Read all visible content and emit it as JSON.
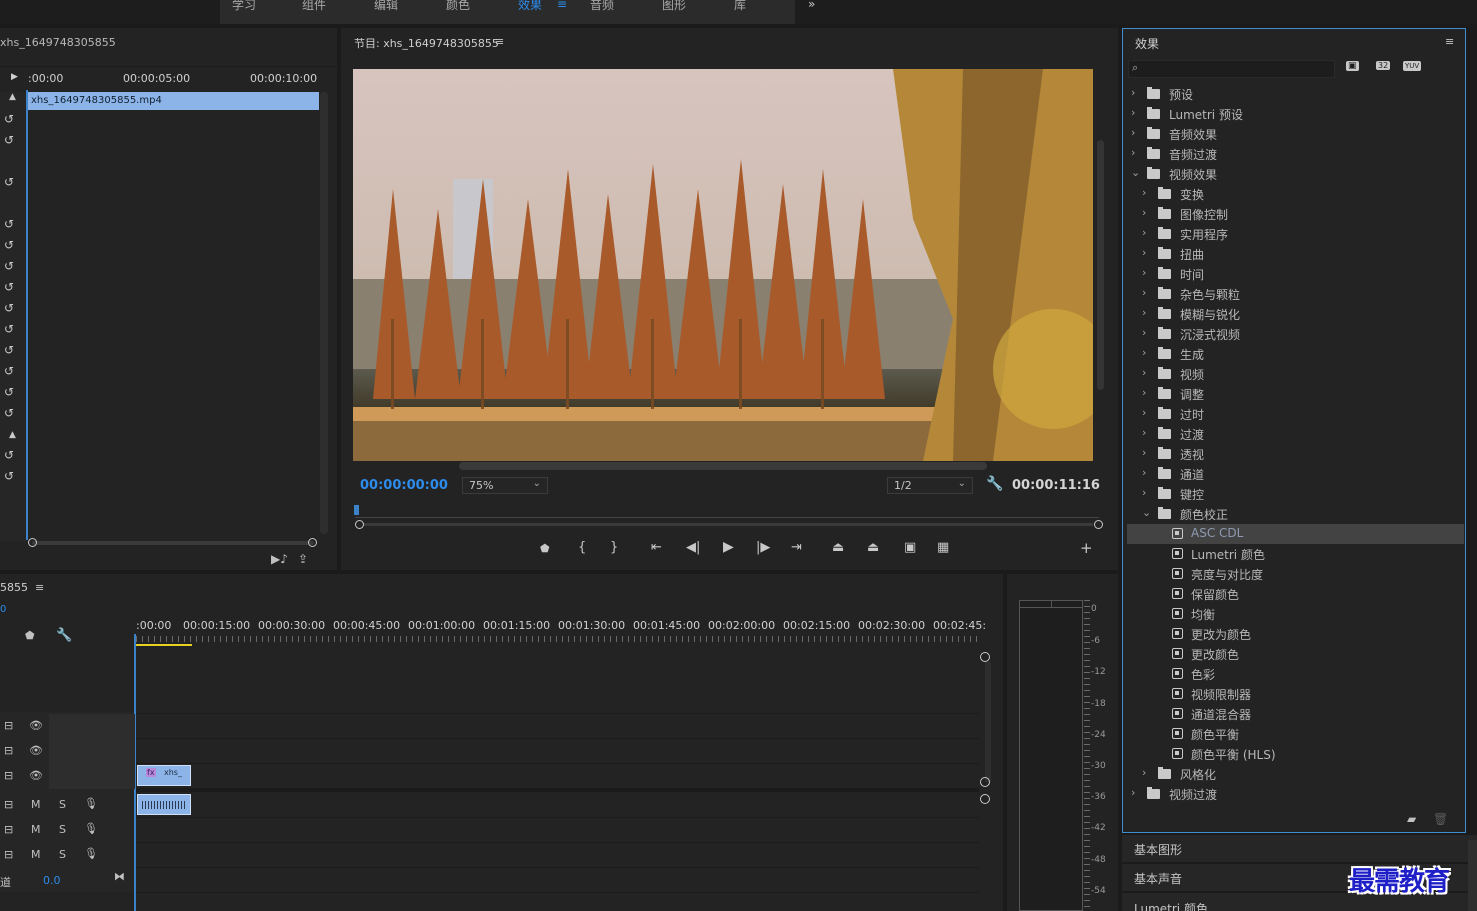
{
  "workspace_tabs": [
    "学习",
    "组件",
    "编辑",
    "颜色",
    "效果",
    "音频",
    "图形",
    "库"
  ],
  "workspace_active": "效果",
  "workspace_menu_icon": "≡",
  "workspace_more_icon": "»",
  "source": {
    "title": "xhs_1649748305855",
    "ruler": [
      ":00:00",
      "00:00:05:00",
      "00:00:10:00"
    ],
    "clip": "xhs_1649748305855.mp4"
  },
  "program": {
    "title": "节目: xhs_1649748305855",
    "menu_icon": "≡",
    "timecode": "00:00:00:00",
    "zoom": "75%",
    "resolution": "1/2",
    "duration": "00:00:11:16",
    "add_icon": "+"
  },
  "timeline": {
    "title": "5855",
    "menu_icon": "≡",
    "start_tc": "0",
    "ruler": [
      ":00:00",
      "00:00:15:00",
      "00:00:30:00",
      "00:00:45:00",
      "00:01:00:00",
      "00:01:15:00",
      "00:01:30:00",
      "00:01:45:00",
      "00:02:00:00",
      "00:02:15:00",
      "00:02:30:00",
      "00:02:45:"
    ],
    "clip_v": "xhs_",
    "clip_fx": "fx",
    "mix_label": "道",
    "mix_value": "0.0",
    "audio_m": "M",
    "audio_s": "S"
  },
  "meter": {
    "scale": [
      "0",
      "-6",
      "-12",
      "-18",
      "-24",
      "-30",
      "-36",
      "-42",
      "-48",
      "-54"
    ]
  },
  "effects": {
    "title": "效果",
    "menu_icon": "≡",
    "search_placeholder": "",
    "items": [
      {
        "label": "预设",
        "level": 0,
        "open": false,
        "kind": "preset"
      },
      {
        "label": "Lumetri 预设",
        "level": 0,
        "open": false,
        "kind": "preset"
      },
      {
        "label": "音频效果",
        "level": 0,
        "open": false,
        "kind": "folder"
      },
      {
        "label": "音频过渡",
        "level": 0,
        "open": false,
        "kind": "folder"
      },
      {
        "label": "视频效果",
        "level": 0,
        "open": true,
        "kind": "folder"
      },
      {
        "label": "变换",
        "level": 1,
        "open": false,
        "kind": "folder"
      },
      {
        "label": "图像控制",
        "level": 1,
        "open": false,
        "kind": "folder"
      },
      {
        "label": "实用程序",
        "level": 1,
        "open": false,
        "kind": "folder"
      },
      {
        "label": "扭曲",
        "level": 1,
        "open": false,
        "kind": "folder"
      },
      {
        "label": "时间",
        "level": 1,
        "open": false,
        "kind": "folder"
      },
      {
        "label": "杂色与颗粒",
        "level": 1,
        "open": false,
        "kind": "folder"
      },
      {
        "label": "模糊与锐化",
        "level": 1,
        "open": false,
        "kind": "folder"
      },
      {
        "label": "沉浸式视频",
        "level": 1,
        "open": false,
        "kind": "folder"
      },
      {
        "label": "生成",
        "level": 1,
        "open": false,
        "kind": "folder"
      },
      {
        "label": "视频",
        "level": 1,
        "open": false,
        "kind": "folder"
      },
      {
        "label": "调整",
        "level": 1,
        "open": false,
        "kind": "folder"
      },
      {
        "label": "过时",
        "level": 1,
        "open": false,
        "kind": "folder"
      },
      {
        "label": "过渡",
        "level": 1,
        "open": false,
        "kind": "folder"
      },
      {
        "label": "透视",
        "level": 1,
        "open": false,
        "kind": "folder"
      },
      {
        "label": "通道",
        "level": 1,
        "open": false,
        "kind": "folder"
      },
      {
        "label": "键控",
        "level": 1,
        "open": false,
        "kind": "folder"
      },
      {
        "label": "颜色校正",
        "level": 1,
        "open": true,
        "kind": "folder"
      },
      {
        "label": "ASC CDL",
        "level": 2,
        "kind": "fx",
        "selected": true
      },
      {
        "label": "Lumetri 颜色",
        "level": 2,
        "kind": "fx"
      },
      {
        "label": "亮度与对比度",
        "level": 2,
        "kind": "fx"
      },
      {
        "label": "保留颜色",
        "level": 2,
        "kind": "fx"
      },
      {
        "label": "均衡",
        "level": 2,
        "kind": "fx"
      },
      {
        "label": "更改为颜色",
        "level": 2,
        "kind": "fx"
      },
      {
        "label": "更改颜色",
        "level": 2,
        "kind": "fx"
      },
      {
        "label": "色彩",
        "level": 2,
        "kind": "fx"
      },
      {
        "label": "视频限制器",
        "level": 2,
        "kind": "fx"
      },
      {
        "label": "通道混合器",
        "level": 2,
        "kind": "fx"
      },
      {
        "label": "颜色平衡",
        "level": 2,
        "kind": "fx"
      },
      {
        "label": "颜色平衡 (HLS)",
        "level": 2,
        "kind": "fx"
      },
      {
        "label": "风格化",
        "level": 1,
        "open": false,
        "kind": "folder"
      },
      {
        "label": "视频过渡",
        "level": 0,
        "open": false,
        "kind": "folder"
      }
    ],
    "badges": [
      "32",
      "YUV"
    ]
  },
  "dock_panels": [
    "基本图形",
    "基本声音",
    "Lumetri 颜色"
  ],
  "watermark": "最需教育",
  "colors": {
    "accent": "#2d8ceb",
    "clip": "#8cb4e8",
    "selection": "#434343"
  }
}
